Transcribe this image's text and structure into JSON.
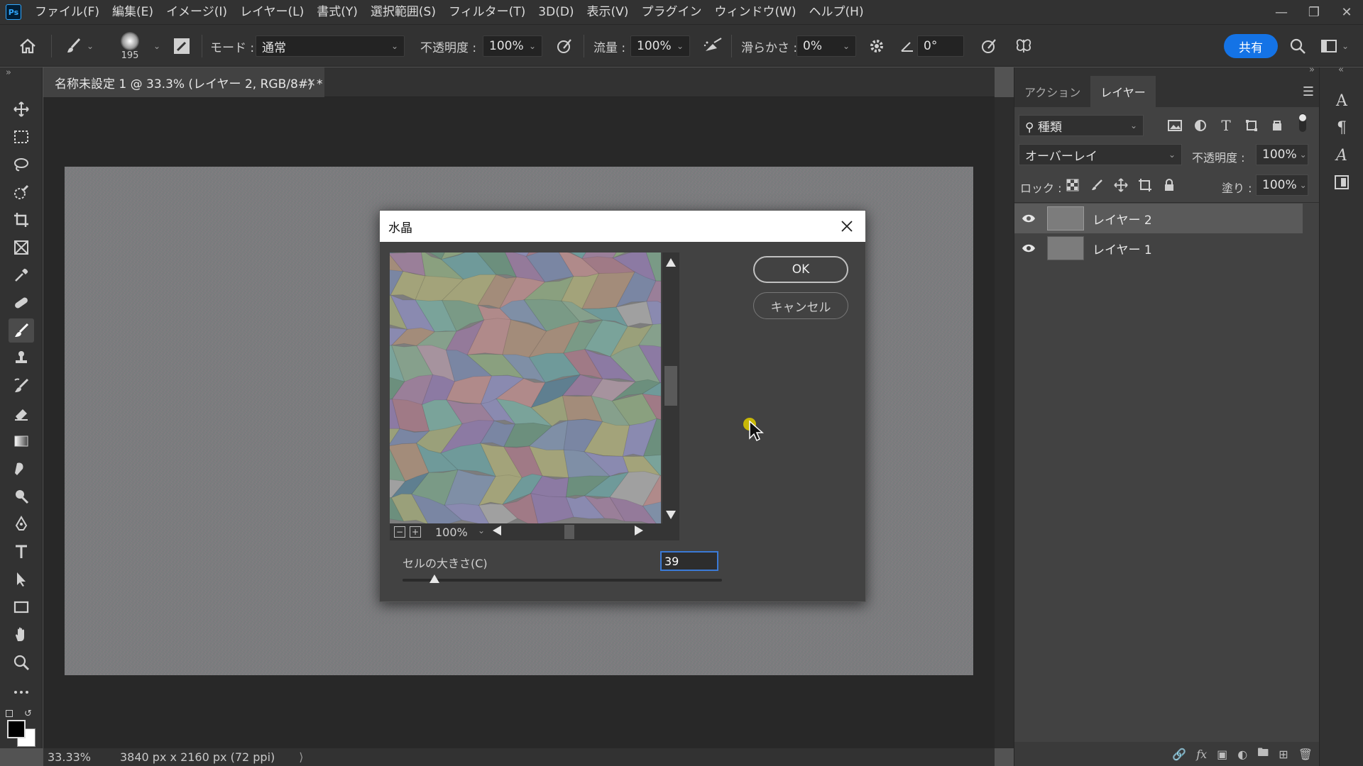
{
  "menubar": {
    "items": [
      "ファイル(F)",
      "編集(E)",
      "イメージ(I)",
      "レイヤー(L)",
      "書式(Y)",
      "選択範囲(S)",
      "フィルター(T)",
      "3D(D)",
      "表示(V)",
      "プラグイン",
      "ウィンドウ(W)",
      "ヘルプ(H)"
    ]
  },
  "app": {
    "logo": "Ps"
  },
  "options": {
    "brush_size": "195",
    "mode_label": "モード :",
    "mode_value": "通常",
    "opacity_label": "不透明度 :",
    "opacity_value": "100%",
    "flow_label": "流量 :",
    "flow_value": "100%",
    "smoothing_label": "滑らかさ :",
    "smoothing_value": "0%",
    "angle_value": "0°",
    "share_label": "共有"
  },
  "document": {
    "tab_title": "名称未設定 1 @ 33.3% (レイヤー 2, RGB/8#) *",
    "zoom": "33.33%",
    "dimensions": "3840 px x 2160 px (72 ppi)"
  },
  "panel": {
    "tabs": [
      "アクション",
      "レイヤー"
    ],
    "active_tab": 1,
    "filter_label": "種類",
    "blend_mode": "オーバーレイ",
    "opacity_label": "不透明度 :",
    "opacity_value": "100%",
    "lock_label": "ロック :",
    "fill_label": "塗り :",
    "fill_value": "100%",
    "layers": [
      {
        "name": "レイヤー 2",
        "selected": true
      },
      {
        "name": "レイヤー 1",
        "selected": false
      }
    ]
  },
  "dialog": {
    "title": "水晶",
    "ok_label": "OK",
    "cancel_label": "キャンセル",
    "preview_zoom": "100%",
    "cell_size_label": "セルの大きさ(C)",
    "cell_size_value": "39",
    "cell_size_slider_fraction": 0.1
  },
  "colors": {
    "accent": "#1473e6",
    "panel_bg": "#424242",
    "app_bg": "#323232",
    "canvas_bg": "#282828",
    "cursor_highlight": "#d6c400"
  }
}
